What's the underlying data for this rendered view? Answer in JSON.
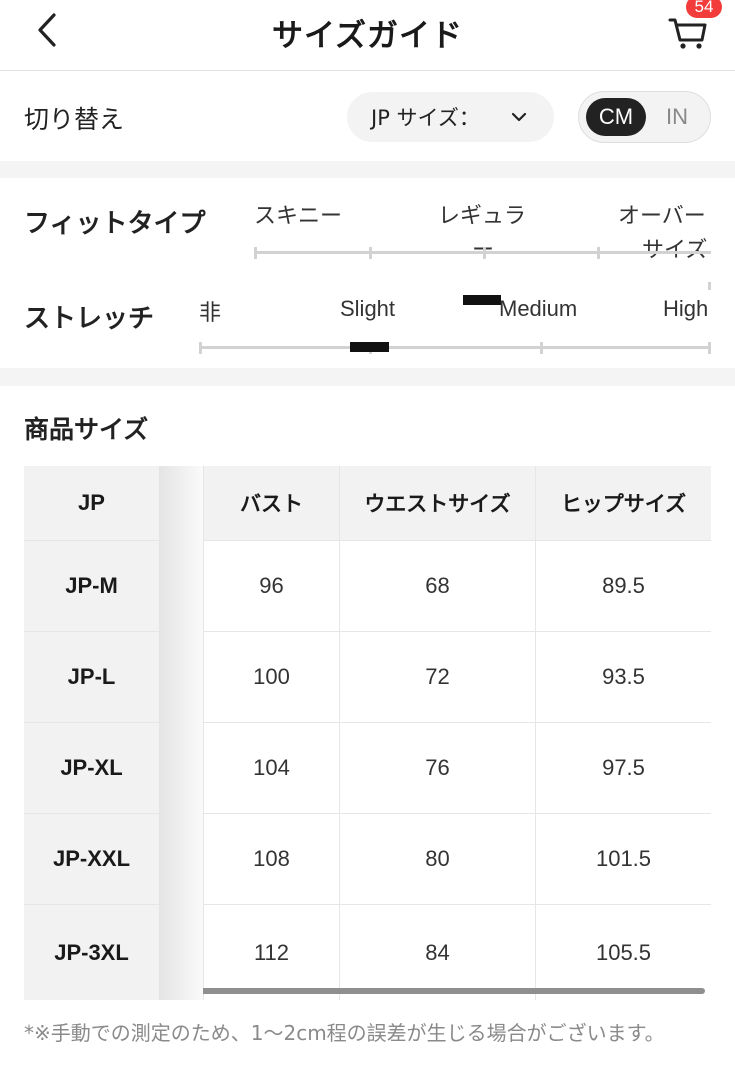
{
  "header": {
    "title": "サイズガイド",
    "cart_count": "54"
  },
  "switch_row": {
    "label": "切り替え",
    "size_select": "JP サイズ：",
    "unit_cm": "CM",
    "unit_in": "IN",
    "selected_unit": "CM"
  },
  "fit": {
    "label": "フィットタイプ",
    "options": [
      "スキニー",
      "レギュラ",
      "オーバー"
    ],
    "regular_wrap": "ー",
    "oversize_wrap": "サイズ",
    "selected_level": "regular"
  },
  "stretch": {
    "label": "ストレッチ",
    "options": [
      "非",
      "Slight",
      "Medium",
      "High"
    ],
    "selected_level": "slight"
  },
  "product": {
    "title": "商品サイズ",
    "fixed_header": "JP",
    "headers": [
      "バスト",
      "ウエストサイズ",
      "ヒップサイズ"
    ],
    "rows": [
      {
        "size": "JP-M",
        "values": [
          "96",
          "68",
          "89.5"
        ]
      },
      {
        "size": "JP-L",
        "values": [
          "100",
          "72",
          "93.5"
        ]
      },
      {
        "size": "JP-XL",
        "values": [
          "104",
          "76",
          "97.5"
        ]
      },
      {
        "size": "JP-XXL",
        "values": [
          "108",
          "80",
          "101.5"
        ]
      },
      {
        "size": "JP-3XL",
        "values": [
          "112",
          "84",
          "105.5"
        ]
      }
    ]
  },
  "note": "*※手動での測定のため、1〜2cm程の誤差が生じる場合がございます。",
  "icons": {
    "back": "chevron-left-icon",
    "cart": "cart-icon",
    "select": "chevron-down-icon"
  },
  "colors": {
    "badge": "#f23c3c",
    "toggle_active": "#222222"
  }
}
